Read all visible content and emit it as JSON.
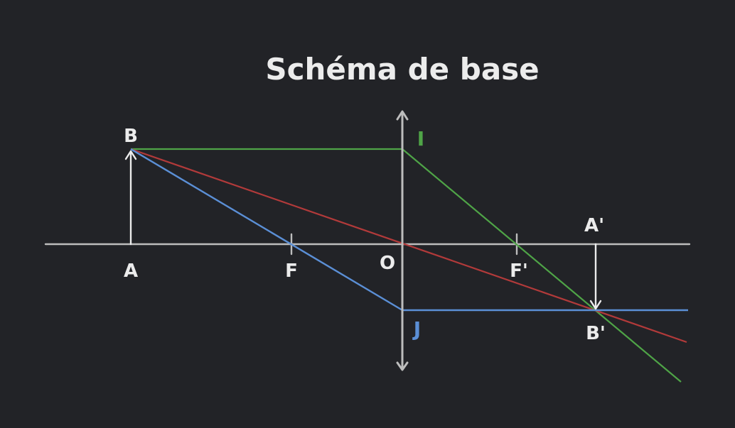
{
  "title": "Schéma de base",
  "labels": {
    "A": "A",
    "B": "B",
    "F": "F",
    "O": "O",
    "F_prime": "F'",
    "A_prime": "A'",
    "B_prime": "B'",
    "I": "I",
    "J": "J"
  },
  "colors": {
    "background": "#222327",
    "axis": "#bdbdbd",
    "text": "#ececec",
    "ray_parallel": "#4fa447",
    "ray_center": "#b23a3a",
    "ray_focal": "#5b8fd6",
    "label_I": "#4fa447",
    "label_J": "#5b8fd6"
  },
  "icons": {
    "lens": "double-arrow-lens",
    "object": "up-arrow",
    "image": "down-arrow"
  }
}
